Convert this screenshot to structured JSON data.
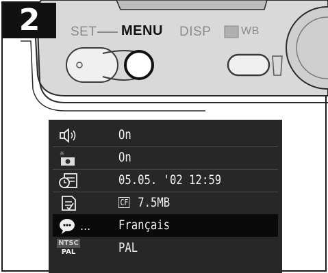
{
  "step": {
    "number": "2"
  },
  "camera": {
    "set_label": "SET",
    "menu_label": "MENU",
    "disp_label": "DISP",
    "wb_label": "WB"
  },
  "menu": {
    "rows": [
      {
        "icon": "speaker-icon",
        "value": "On",
        "selected": false
      },
      {
        "icon": "startup-image-icon",
        "value": "On",
        "selected": false
      },
      {
        "icon": "date-time-icon",
        "value": "05.05. '02 12:59",
        "selected": false
      },
      {
        "icon": "format-card-icon",
        "badge": "CF",
        "value": "7.5MB",
        "selected": false
      },
      {
        "icon": "language-icon",
        "icon_suffix": "...",
        "value": "Français",
        "selected": true
      },
      {
        "icon": "video-system-icon",
        "icon_top": "NTSC",
        "icon_bottom": "PAL",
        "value": "PAL",
        "selected": false
      }
    ]
  },
  "colors": {
    "lcd_bg": "#272727",
    "selected_row": "#0a0a0a",
    "text": "#f2f2f2"
  }
}
